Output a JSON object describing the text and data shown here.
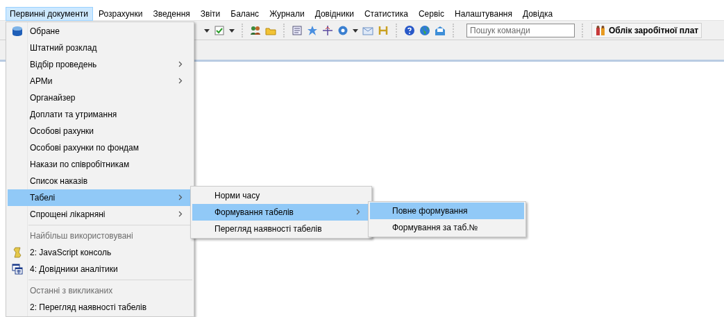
{
  "menubar": [
    {
      "label": "Первинні документи",
      "selected": true
    },
    {
      "label": "Розрахунки",
      "selected": false
    },
    {
      "label": "Зведення",
      "selected": false
    },
    {
      "label": "Звіти",
      "selected": false
    },
    {
      "label": "Баланс",
      "selected": false
    },
    {
      "label": "Журнали",
      "selected": false
    },
    {
      "label": "Довідники",
      "selected": false
    },
    {
      "label": "Статистика",
      "selected": false
    },
    {
      "label": "Сервіс",
      "selected": false
    },
    {
      "label": "Налаштування",
      "selected": false
    },
    {
      "label": "Довідка",
      "selected": false
    }
  ],
  "toolbar": {
    "search": {
      "placeholder": "Пошук команди"
    },
    "button": {
      "label": "Облік заробітної плат"
    }
  },
  "menu": {
    "items": [
      {
        "kind": "item",
        "label": "Обране",
        "submenu": false,
        "selected": false
      },
      {
        "kind": "item",
        "label": "Штатний розклад",
        "submenu": false,
        "selected": false
      },
      {
        "kind": "item",
        "label": "Відбір проведень",
        "submenu": true,
        "selected": false
      },
      {
        "kind": "item",
        "label": "АРМи",
        "submenu": true,
        "selected": false
      },
      {
        "kind": "item",
        "label": "Органайзер",
        "submenu": false,
        "selected": false
      },
      {
        "kind": "item",
        "label": "Доплати та утримання",
        "submenu": false,
        "selected": false
      },
      {
        "kind": "item",
        "label": "Особові рахунки",
        "submenu": false,
        "selected": false
      },
      {
        "kind": "item",
        "label": "Особові рахунки по фондам",
        "submenu": false,
        "selected": false
      },
      {
        "kind": "item",
        "label": "Накази по співробітникам",
        "submenu": false,
        "selected": false
      },
      {
        "kind": "item",
        "label": "Список наказів",
        "submenu": false,
        "selected": false
      },
      {
        "kind": "item",
        "label": "Табелі",
        "submenu": true,
        "selected": true
      },
      {
        "kind": "item",
        "label": "Спрощені лікарняні",
        "submenu": true,
        "selected": false
      },
      {
        "kind": "header",
        "label": "Найбільш використовувані"
      },
      {
        "kind": "item",
        "label": "2: JavaScript консоль",
        "submenu": false,
        "selected": false
      },
      {
        "kind": "item",
        "label": "4: Довідники аналітики",
        "submenu": false,
        "selected": false
      },
      {
        "kind": "header",
        "label": "Останні з викликаних"
      },
      {
        "kind": "item",
        "label": "2: Перегляд наявності табелів",
        "submenu": false,
        "selected": false
      }
    ]
  },
  "submenu": {
    "items": [
      {
        "label": "Норми часу",
        "submenu": false,
        "selected": false
      },
      {
        "label": "Формування табелів",
        "submenu": true,
        "selected": true
      },
      {
        "label": "Перегляд наявності табелів",
        "submenu": false,
        "selected": false
      }
    ]
  },
  "subsubmenu": {
    "items": [
      {
        "label": "Повне формування",
        "submenu": false,
        "selected": true
      },
      {
        "label": "Формування за таб.№",
        "submenu": false,
        "selected": false
      }
    ]
  }
}
